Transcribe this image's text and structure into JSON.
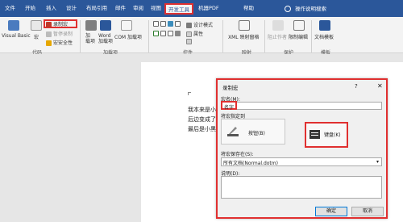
{
  "tabs": [
    "文件",
    "开始",
    "插入",
    "设计",
    "布局",
    "引用",
    "邮件",
    "审阅",
    "视图",
    "开发工具",
    "机器PDF",
    "帮助"
  ],
  "active_tab": "开发工具",
  "tell_me": "操作说明搜索",
  "ribbon": {
    "code": {
      "visual_basic": "Visual Basic",
      "macro": "宏",
      "record_macro": "录制宏",
      "pause_recording": "暂停录制",
      "macro_security": "宏安全性",
      "group": "代码"
    },
    "addins": {
      "addin": "加\n载项",
      "word_addin": "Word\n加载项",
      "com_addin": "COM 加载项",
      "group": "加载项"
    },
    "controls": {
      "design_mode": "设计模式",
      "properties": "属性",
      "group": "控件"
    },
    "mapping": {
      "xml_pane": "XML 映射窗格",
      "group": "映射"
    },
    "protect": {
      "block_authors": "阻止作者",
      "restrict_editing": "限制编辑",
      "group": "保护"
    },
    "templates": {
      "doc_template": "文档模板",
      "group": "模板"
    }
  },
  "document_lines": [
    "我本来是小",
    "后边变成了",
    "最后是小黑"
  ],
  "dialog": {
    "title": "录制宏",
    "help": "?",
    "close": "✕",
    "macro_name_label": "宏名(M):",
    "macro_name_value": "名字",
    "assign_label": "将宏指定到",
    "button_label": "按钮(B)",
    "keyboard_label": "键盘(K)",
    "store_label": "将宏保存在(S):",
    "store_value": "所有文档(Normal.dotm)",
    "description_label": "说明(D):",
    "ok": "确定",
    "cancel": "取消"
  },
  "colors": {
    "accent": "#2b579a",
    "highlight": "#e03030"
  }
}
